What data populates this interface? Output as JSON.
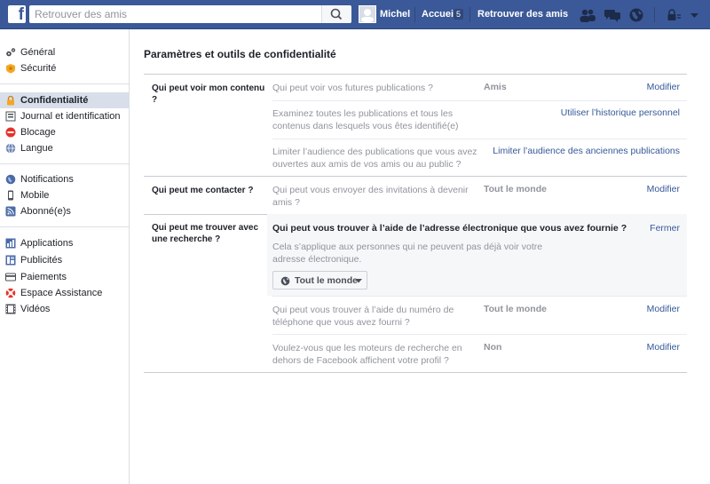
{
  "topbar": {
    "search_placeholder": "Retrouver des amis",
    "user_name": "Michel",
    "home_label": "Accueil",
    "home_count": "5",
    "find_friends_label": "Retrouver des amis"
  },
  "sidebar": {
    "items": [
      {
        "label": "Général"
      },
      {
        "label": "Sécurité"
      },
      {
        "label": "Confidentialité"
      },
      {
        "label": "Journal et identification"
      },
      {
        "label": "Blocage"
      },
      {
        "label": "Langue"
      },
      {
        "label": "Notifications"
      },
      {
        "label": "Mobile"
      },
      {
        "label": "Abonné(e)s"
      },
      {
        "label": "Applications"
      },
      {
        "label": "Publicités"
      },
      {
        "label": "Paiements"
      },
      {
        "label": "Espace Assistance"
      },
      {
        "label": "Vidéos"
      }
    ]
  },
  "main": {
    "title": "Paramètres et outils de confidentialité",
    "sections": [
      {
        "heading": "Qui peut voir mon contenu ?",
        "rows": [
          {
            "question": "Qui peut voir vos futures publications ?",
            "value": "Amis",
            "action": "Modifier"
          },
          {
            "question": "Examinez toutes les publications et tous les contenus dans lesquels vous êtes identifié(e)",
            "value": "",
            "action": "Utiliser l’historique personnel"
          },
          {
            "question": "Limiter l’audience des publications que vous avez ouvertes aux amis de vos amis ou au public ?",
            "value": "",
            "action": "Limiter l’audience des anciennes publications"
          }
        ]
      },
      {
        "heading": "Qui peut me contacter ?",
        "rows": [
          {
            "question": "Qui peut vous envoyer des invitations à devenir amis ?",
            "value": "Tout le monde",
            "action": "Modifier"
          }
        ]
      },
      {
        "heading": "Qui peut me trouver avec une recherche ?",
        "expanded": {
          "question": "Qui peut vous trouver à l’aide de l’adresse électronique que vous avez fournie ?",
          "action": "Fermer",
          "description": "Cela s’applique aux personnes qui ne peuvent pas déjà voir votre adresse électronique.",
          "audience": "Tout le monde"
        },
        "rows": [
          {
            "question": "Qui peut vous trouver à l’aide du numéro de téléphone que vous avez fourni ?",
            "value": "Tout le monde",
            "action": "Modifier"
          },
          {
            "question": "Voulez-vous que les moteurs de recherche en dehors de Facebook affichent votre profil ?",
            "value": "Non",
            "action": "Modifier"
          }
        ]
      }
    ]
  },
  "colors": {
    "brand": "#3b5998",
    "link": "#365899",
    "active_bg": "#d8dfea"
  }
}
